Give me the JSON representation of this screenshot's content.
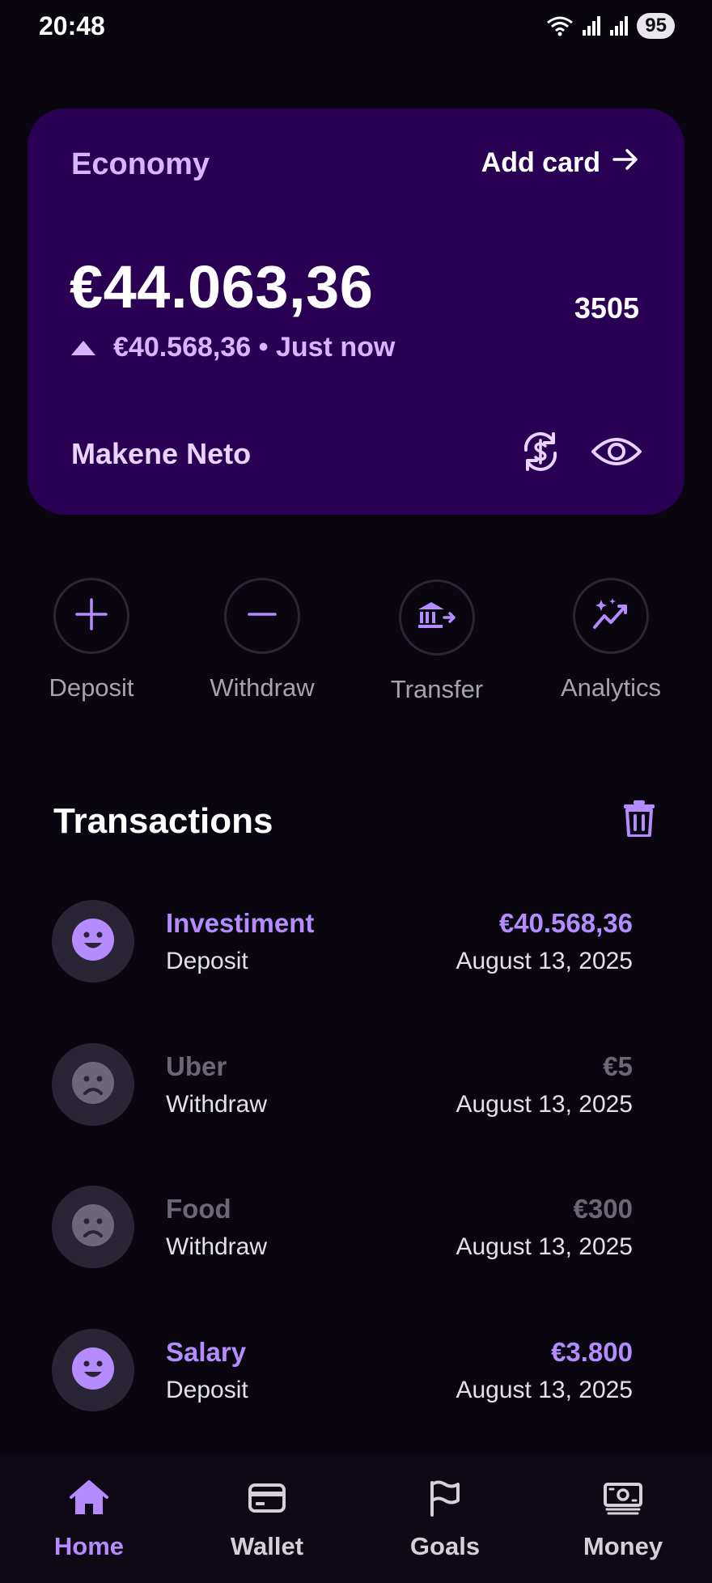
{
  "status": {
    "time": "20:48",
    "battery": "95"
  },
  "card": {
    "title": "Economy",
    "add_card_label": "Add card",
    "balance": "€44.063,36",
    "change_text": "€40.568,36 • Just now",
    "card_number": "3505",
    "holder": "Makene Neto"
  },
  "actions": [
    {
      "label": "Deposit",
      "icon": "plus-icon"
    },
    {
      "label": "Withdraw",
      "icon": "minus-icon"
    },
    {
      "label": "Transfer",
      "icon": "bank-transfer-icon"
    },
    {
      "label": "Analytics",
      "icon": "sparkle-chart-icon"
    }
  ],
  "transactions": {
    "title": "Transactions",
    "items": [
      {
        "name": "Investiment",
        "type": "Deposit",
        "amount": "€40.568,36",
        "date": "August 13, 2025",
        "mood": "happy"
      },
      {
        "name": "Uber",
        "type": "Withdraw",
        "amount": "€5",
        "date": "August 13, 2025",
        "mood": "sad"
      },
      {
        "name": "Food",
        "type": "Withdraw",
        "amount": "€300",
        "date": "August 13, 2025",
        "mood": "sad"
      },
      {
        "name": "Salary",
        "type": "Deposit",
        "amount": "€3.800",
        "date": "August 13, 2025",
        "mood": "happy"
      }
    ]
  },
  "nav": [
    {
      "label": "Home",
      "icon": "home-icon",
      "active": true
    },
    {
      "label": "Wallet",
      "icon": "wallet-icon",
      "active": false
    },
    {
      "label": "Goals",
      "icon": "flag-icon",
      "active": false
    },
    {
      "label": "Money",
      "icon": "banknote-icon",
      "active": false
    }
  ],
  "colors": {
    "background": "#09060f",
    "card": "#2a0054",
    "accent": "#b48cff",
    "card_title": "#d8b6ff",
    "muted": "#6c6776"
  }
}
